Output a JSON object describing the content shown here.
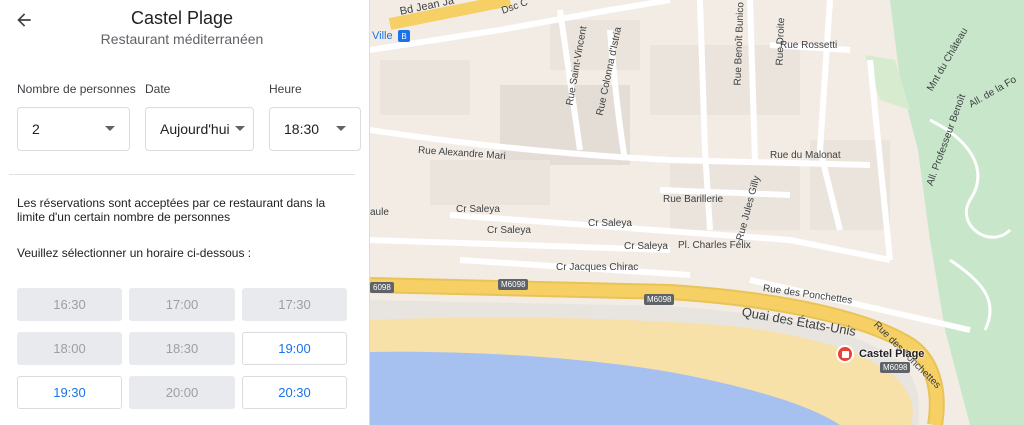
{
  "header": {
    "title": "Castel Plage",
    "subtitle": "Restaurant méditerranéen"
  },
  "form": {
    "party_size": {
      "label": "Nombre de personnes",
      "value": "2"
    },
    "date": {
      "label": "Date",
      "value": "Aujourd'hui"
    },
    "time": {
      "label": "Heure",
      "value": "18:30"
    }
  },
  "info_text": "Les réservations sont acceptées par ce restaurant dans la limite d'un certain nombre de personnes",
  "prompt_text": "Veuillez sélectionner un horaire ci-dessous :",
  "time_slots": [
    {
      "time": "16:30",
      "available": false
    },
    {
      "time": "17:00",
      "available": false
    },
    {
      "time": "17:30",
      "available": false
    },
    {
      "time": "18:00",
      "available": false
    },
    {
      "time": "18:30",
      "available": false
    },
    {
      "time": "19:00",
      "available": true
    },
    {
      "time": "19:30",
      "available": true
    },
    {
      "time": "20:00",
      "available": false
    },
    {
      "time": "20:30",
      "available": true
    }
  ],
  "map": {
    "streets": {
      "bd_jean": "Bd Jean Ja",
      "dsc": "Dsc C",
      "ville": "Ville",
      "saint_vincent": "Rue Saint-Vincent",
      "colonna": "Rue Colonna d'Istria",
      "benoit_bunico": "Rue Benoît Bunico",
      "droite": "Rue Droite",
      "rossetti": "Rue Rossetti",
      "mnt_chateau": "Mnt du Château",
      "all_fo": "All. de la Fo",
      "alexandre_mari": "Rue Alexandre Mari",
      "malonat": "Rue du Malonat",
      "professeur_benoit": "All. Professeur Benoît",
      "barillerie": "Rue Barillerie",
      "jules_gilly": "Rue Jules Gilly",
      "saule": "aule",
      "saleya_1": "Cr Saleya",
      "saleya_2": "Cr Saleya",
      "saleya_3": "Cr Saleya",
      "saleya_4": "Cr Saleya",
      "charles_felix": "Pl. Charles Félix",
      "jacques_chirac": "Cr Jacques Chirac",
      "ponchettes_1": "Rue des Ponchettes",
      "ponchettes_2": "Rue des Ponchettes",
      "quai": "Quai des États-Unis"
    },
    "shields": {
      "m1": "M6098",
      "m2": "M6098",
      "m3": "M6098",
      "m4": "6098"
    },
    "poi_label": "Castel Plage"
  },
  "colors": {
    "accent": "#1a73e8",
    "disabled_bg": "#e8eaed",
    "disabled_text": "#9aa0a6",
    "sea": "#a6c0f0",
    "beach": "#f7e1a8",
    "road_yellow": "#f6cf65",
    "park": "#c8e6c9",
    "marker": "#ea4335"
  }
}
